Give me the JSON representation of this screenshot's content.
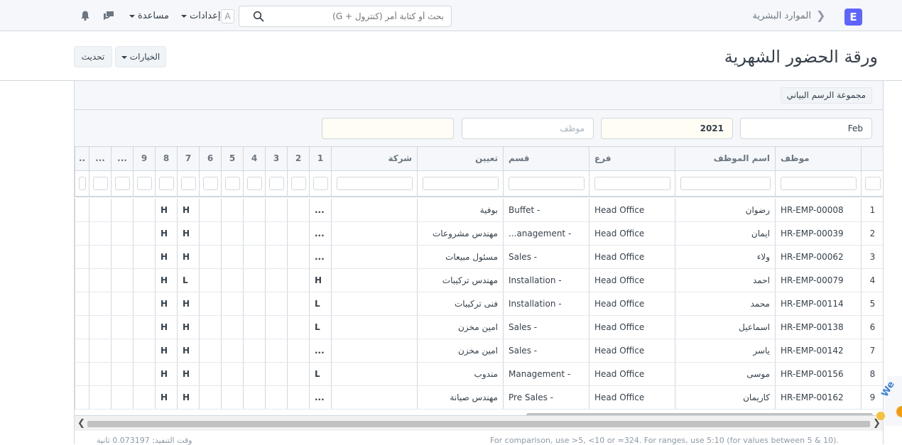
{
  "navbar": {
    "logo": "E",
    "breadcrumb": "الموارد البشرية",
    "search_placeholder": "بحث أو كتابة أمر (كنترول + G)",
    "avatar": "A",
    "settings": "إعدادات",
    "help": "مساعدة"
  },
  "page": {
    "title": "ورقة الحضور الشهرية",
    "options_btn": "الخيارات",
    "refresh_btn": "تحديث"
  },
  "report": {
    "chart_btn": "مجموعة الرسم البياني",
    "filters": {
      "month": "Feb",
      "year": "2021",
      "employee_placeholder": "موظف"
    },
    "columns": [
      "موظف",
      "اسم الموظف",
      "فرع",
      "قسم",
      "تعيين",
      "شركة",
      "1",
      "2",
      "3",
      "4",
      "5",
      "6",
      "7",
      "8",
      "9",
      "...",
      "...",
      ".."
    ],
    "rows": [
      {
        "n": "1",
        "emp": "HR-EMP-00008",
        "name": "رضوان",
        "branch": "Head Office",
        "dept": "Buffet -",
        "desig": "بوفية",
        "d1": "...",
        "d7": "H",
        "d8": "H"
      },
      {
        "n": "2",
        "emp": "HR-EMP-00039",
        "name": "ايمان",
        "branch": "Head Office",
        "dept": "...anagement -",
        "desig": "مهندس مشروعات",
        "d1": "...",
        "d7": "H",
        "d8": "H"
      },
      {
        "n": "3",
        "emp": "HR-EMP-00062",
        "name": "ولاء",
        "branch": "Head Office",
        "dept": "Sales -",
        "desig": "مسئول مبيعات",
        "d1": "...",
        "d7": "H",
        "d8": "H"
      },
      {
        "n": "4",
        "emp": "HR-EMP-00079",
        "name": "احمد",
        "branch": "Head Office",
        "dept": "Installation -",
        "desig": "مهندس تركيبات",
        "d1": "H",
        "d7": "L",
        "d8": "H"
      },
      {
        "n": "5",
        "emp": "HR-EMP-00114",
        "name": "محمد",
        "branch": "Head Office",
        "dept": "Installation -",
        "desig": "فنى تركيبات",
        "d1": "L",
        "d7": "H",
        "d8": "H"
      },
      {
        "n": "6",
        "emp": "HR-EMP-00138",
        "name": "اسماعيل",
        "branch": "Head Office",
        "dept": "Sales -",
        "desig": "امين مخزن",
        "d1": "L",
        "d7": "H",
        "d8": "H"
      },
      {
        "n": "7",
        "emp": "HR-EMP-00142",
        "name": "ياسر",
        "branch": "Head Office",
        "dept": "Sales -",
        "desig": "امين مخزن",
        "d1": "...",
        "d7": "H",
        "d8": "H"
      },
      {
        "n": "8",
        "emp": "HR-EMP-00156",
        "name": "موسى",
        "branch": "Head Office",
        "dept": "Management -",
        "desig": "مندوب",
        "d1": "L",
        "d7": "H",
        "d8": "H"
      },
      {
        "n": "9",
        "emp": "HR-EMP-00162",
        "name": "كاريمان",
        "branch": "Head Office",
        "dept": "Pre Sales -",
        "desig": "مهندس صيانة",
        "d1": "...",
        "d7": "H",
        "d8": "H"
      }
    ]
  },
  "footer": {
    "exec_time": "وقت التنفيذ: 0.073197 ثانية",
    "hint": "For comparison, use >5, <10 or =324. For ranges, use 5:10 (for values between 5 & 10)."
  }
}
